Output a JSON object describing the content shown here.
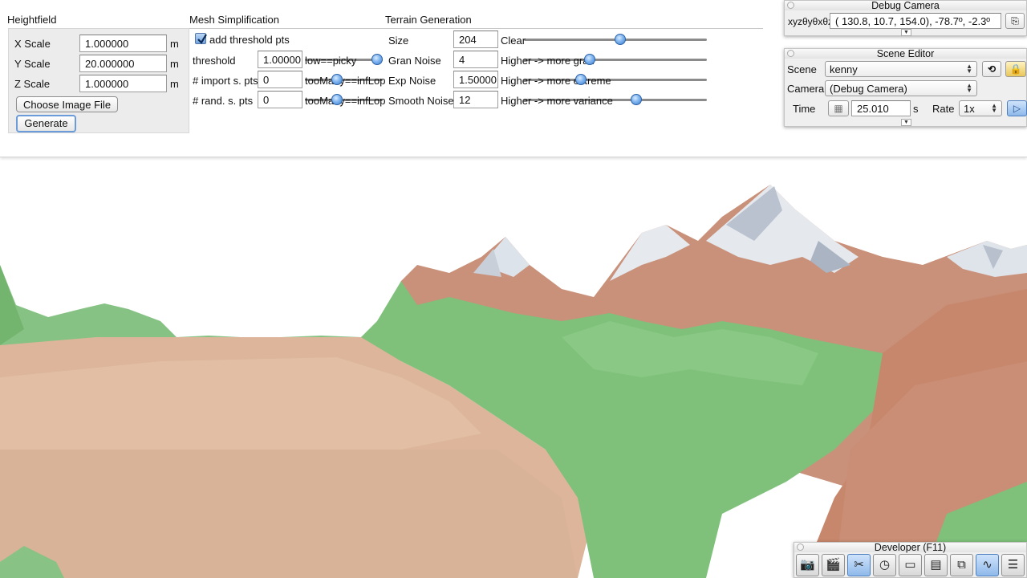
{
  "heightfield": {
    "title": "Heightfield",
    "x_scale": {
      "label": "X Scale",
      "value": "1.000000",
      "unit": "m"
    },
    "y_scale": {
      "label": "Y Scale",
      "value": "20.000000",
      "unit": "m"
    },
    "z_scale": {
      "label": "Z Scale",
      "value": "1.000000",
      "unit": "m"
    },
    "choose_button": "Choose Image File",
    "generate_button": "Generate"
  },
  "mesh": {
    "title": "Mesh Simplification",
    "add_threshold": {
      "label": "add threshold pts",
      "checked": true
    },
    "threshold": {
      "label": "threshold",
      "value": "1.00000",
      "slider_caption": "low==picky",
      "level": 1.0
    },
    "import_pts": {
      "label": "# import s. pts",
      "value": "0",
      "slider_caption": "tooMany==infLop",
      "level": 0.0
    },
    "rand_pts": {
      "label": "# rand. s. pts",
      "value": "0",
      "slider_caption": "tooMany==infLop",
      "level": 0.0
    }
  },
  "terrain": {
    "title": "Terrain Generation",
    "size": {
      "label": "Size",
      "value": "204",
      "slider_caption": "Clear",
      "level": 0.53
    },
    "gran_noise": {
      "label": "Gran Noise",
      "value": "4",
      "slider_caption": "Higher -> more gran",
      "level": 0.35
    },
    "exp_noise": {
      "label": "Exp Noise",
      "value": "1.50000",
      "slider_caption": "Higher -> more extreme",
      "level": 0.3
    },
    "smooth_noise": {
      "label": "Smooth Noise",
      "value": "12",
      "slider_caption": "Higher -> more variance",
      "level": 0.62
    }
  },
  "debug_camera": {
    "title": "Debug Camera",
    "xyz_label": "xyzθyθxθz",
    "coords": "( 130.8,  10.7,  154.0), -78.7º,  -2.3º"
  },
  "scene_editor": {
    "title": "Scene Editor",
    "scene_label": "Scene",
    "scene_value": "kenny",
    "camera_label": "Camera",
    "camera_value": "(Debug Camera)",
    "time_label": "Time",
    "time_value": "25.010",
    "time_unit": "s",
    "rate_label": "Rate",
    "rate_value": "1x"
  },
  "developer": {
    "title": "Developer (F11)",
    "icons": [
      "camera-icon",
      "clapperboard-icon",
      "tools-icon",
      "clock-icon",
      "new-file-icon",
      "terminal-icon",
      "window-icon",
      "graph-icon",
      "document-icon"
    ]
  },
  "colors": {
    "accent": "#3d7fd1",
    "terrain_green": "#7fbf7a",
    "terrain_brown": "#c98e6e",
    "terrain_sand": "#dfb89d",
    "snow": "#dde3ea"
  }
}
